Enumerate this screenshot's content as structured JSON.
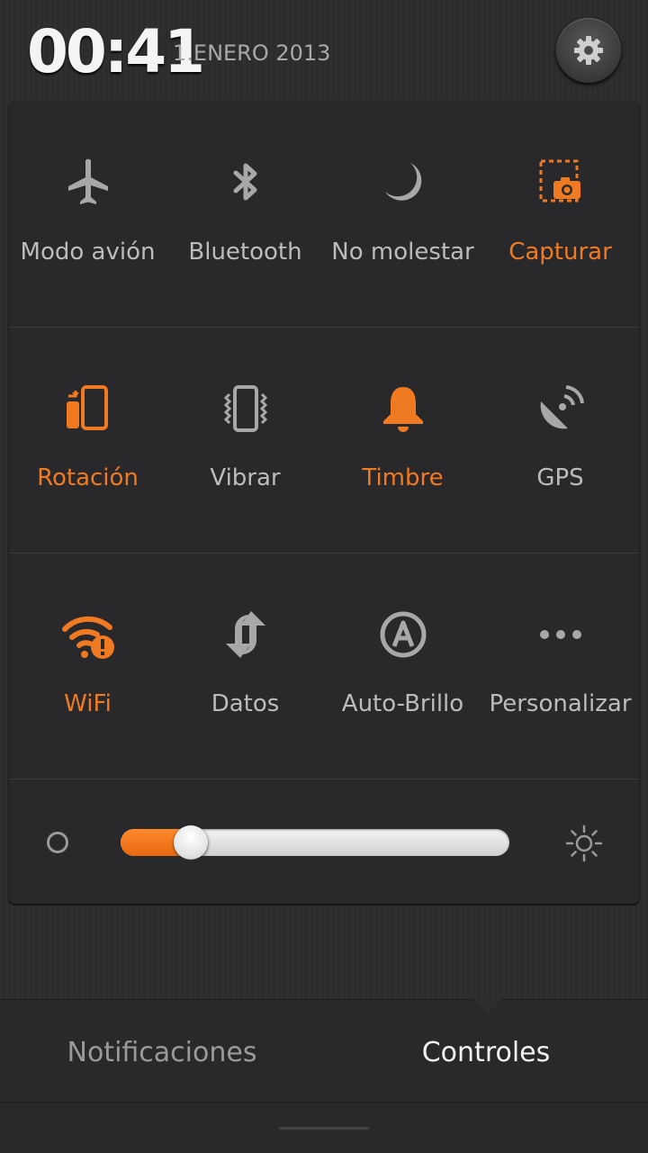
{
  "status": {
    "time": "00:41",
    "date": "1.ENERO 2013"
  },
  "accent_color": "#f07a22",
  "inactive_color": "#a8a8a8",
  "toggles": [
    {
      "label": "Modo avión",
      "icon": "airplane-icon",
      "state": "off"
    },
    {
      "label": "Bluetooth",
      "icon": "bluetooth-icon",
      "state": "off"
    },
    {
      "label": "No molestar",
      "icon": "moon-icon",
      "state": "off"
    },
    {
      "label": "Capturar",
      "icon": "screenshot-icon",
      "state": "on"
    },
    {
      "label": "Rotación",
      "icon": "rotation-icon",
      "state": "on"
    },
    {
      "label": "Vibrar",
      "icon": "vibrate-icon",
      "state": "off"
    },
    {
      "label": "Timbre",
      "icon": "bell-icon",
      "state": "on"
    },
    {
      "label": "GPS",
      "icon": "gps-icon",
      "state": "off"
    },
    {
      "label": "WiFi",
      "icon": "wifi-alert-icon",
      "state": "on"
    },
    {
      "label": "Datos",
      "icon": "data-arrows-icon",
      "state": "off"
    },
    {
      "label": "Auto-Brillo",
      "icon": "auto-brightness-icon",
      "state": "off"
    },
    {
      "label": "Personalizar",
      "icon": "more-dots-icon",
      "state": "off"
    }
  ],
  "brightness": {
    "level": 0.18
  },
  "tabs": {
    "notifications": "Notificaciones",
    "controls": "Controles",
    "active": "controls"
  }
}
